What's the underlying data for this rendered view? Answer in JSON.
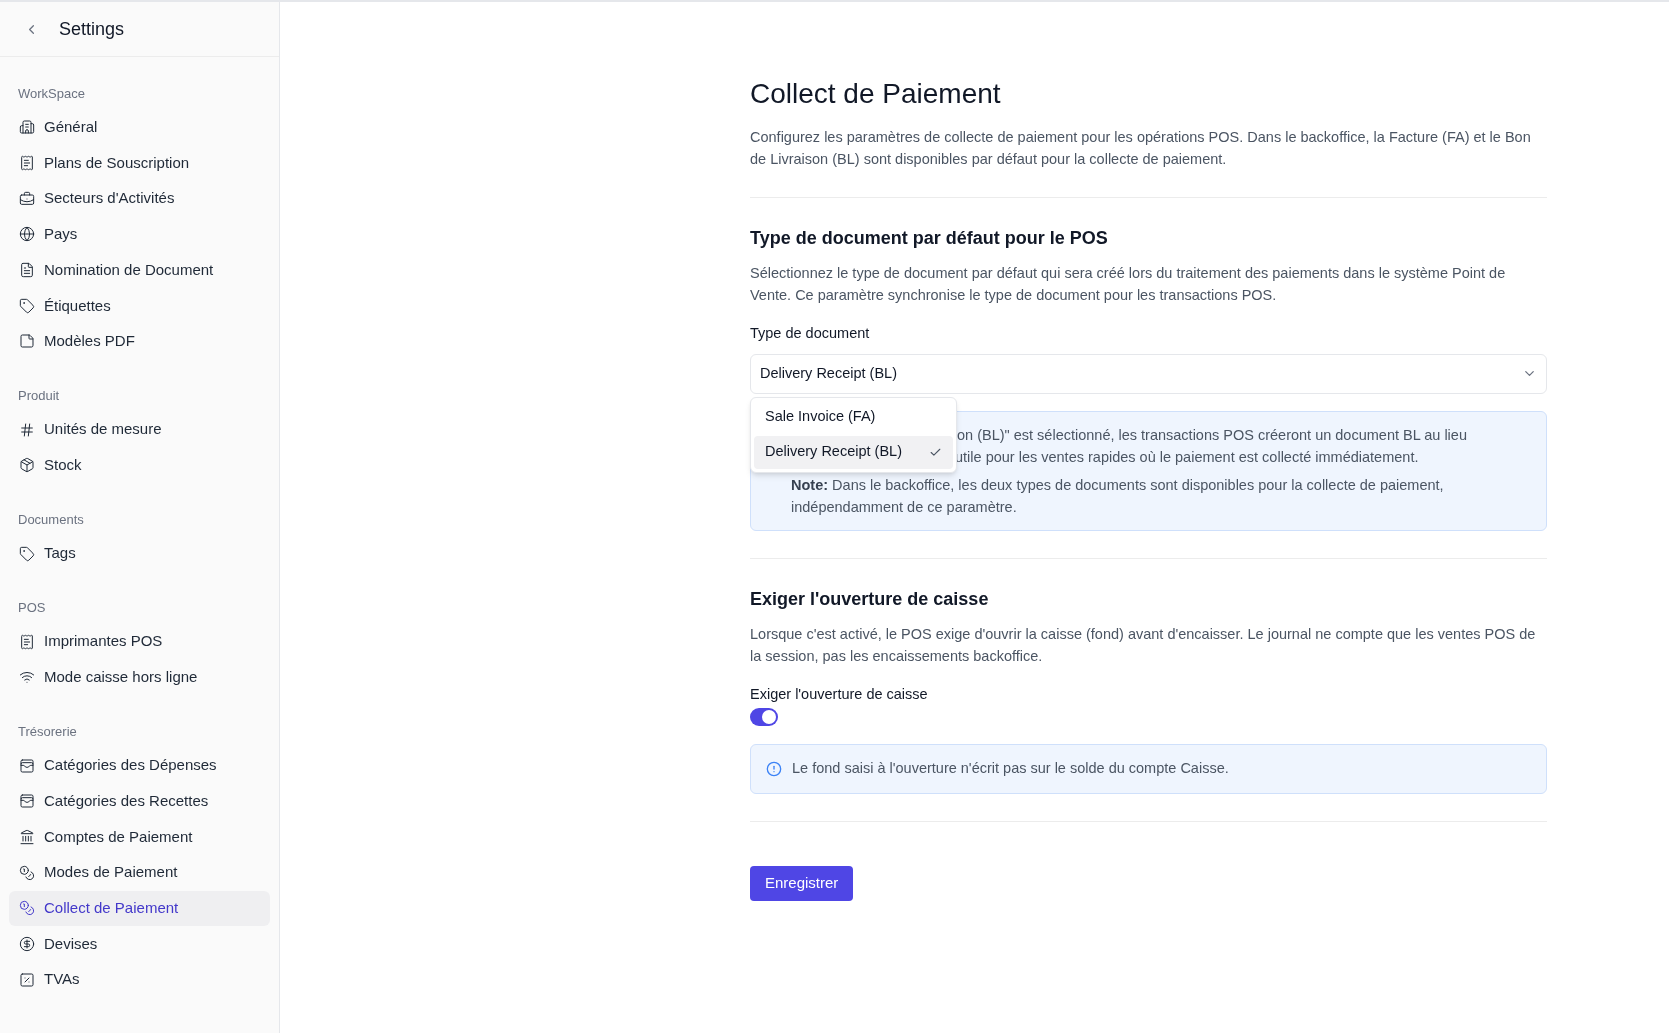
{
  "sidebar": {
    "title": "Settings",
    "sections": [
      {
        "label": "WorkSpace",
        "items": [
          {
            "label": "Général",
            "selected": false
          },
          {
            "label": "Plans de Souscription",
            "selected": false
          },
          {
            "label": "Secteurs d'Activités",
            "selected": false
          },
          {
            "label": "Pays",
            "selected": false
          },
          {
            "label": "Nomination de Document",
            "selected": false
          },
          {
            "label": "Étiquettes",
            "selected": false
          },
          {
            "label": "Modèles PDF",
            "selected": false
          }
        ]
      },
      {
        "label": "Produit",
        "items": [
          {
            "label": "Unités de mesure",
            "selected": false
          },
          {
            "label": "Stock",
            "selected": false
          }
        ]
      },
      {
        "label": "Documents",
        "items": [
          {
            "label": "Tags",
            "selected": false
          }
        ]
      },
      {
        "label": "POS",
        "items": [
          {
            "label": "Imprimantes POS",
            "selected": false
          },
          {
            "label": "Mode caisse hors ligne",
            "selected": false
          }
        ]
      },
      {
        "label": "Trésorerie",
        "items": [
          {
            "label": "Catégories des Dépenses",
            "selected": false
          },
          {
            "label": "Catégories des Recettes",
            "selected": false
          },
          {
            "label": "Comptes de Paiement",
            "selected": false
          },
          {
            "label": "Modes de Paiement",
            "selected": false
          },
          {
            "label": "Collect de Paiement",
            "selected": true
          },
          {
            "label": "Devises",
            "selected": false
          },
          {
            "label": "TVAs",
            "selected": false
          }
        ]
      }
    ]
  },
  "page": {
    "title": "Collect de Paiement",
    "description": "Configurez les paramètres de collecte de paiement pour les opérations POS. Dans le backoffice, la Facture (FA) et le Bon de Livraison (BL) sont disponibles par défaut pour la collecte de paiement."
  },
  "document_section": {
    "heading": "Type de document par défaut pour le POS",
    "description": "Sélectionnez le type de document par défaut qui sera créé lors du traitement des paiements dans le système Point de Vente. Ce paramètre synchronise le type de document pour les transactions POS.",
    "field_label": "Type de document",
    "select": {
      "value": "Delivery Receipt (BL)",
      "open": true,
      "options": [
        {
          "label": "Sale Invoice (FA)",
          "selected": false
        },
        {
          "label": "Delivery Receipt (BL)",
          "selected": true
        }
      ]
    },
    "info": {
      "lines": [
        "on (BL)\" est sélectionné, les transactions POS créeront un document BL au lieu",
        "utile pour les ventes rapides où le paiement est collecté immédiatement."
      ],
      "note_label": "Note:",
      "note": "Dans le backoffice, les deux types de documents sont disponibles pour la collecte de paiement, indépendamment de ce paramètre."
    }
  },
  "cash_section": {
    "heading": "Exiger l'ouverture de caisse",
    "description": "Lorsque c'est activé, le POS exige d'ouvrir la caisse (fond) avant d'encaisser. Le journal ne compte que les ventes POS de la session, pas les encaissements backoffice.",
    "toggle_label": "Exiger l'ouverture de caisse",
    "toggle": {
      "on": true
    },
    "info": "Le fond saisi à l'ouverture n'écrit pas sur le solde du compte Caisse."
  },
  "save_button": "Enregistrer"
}
